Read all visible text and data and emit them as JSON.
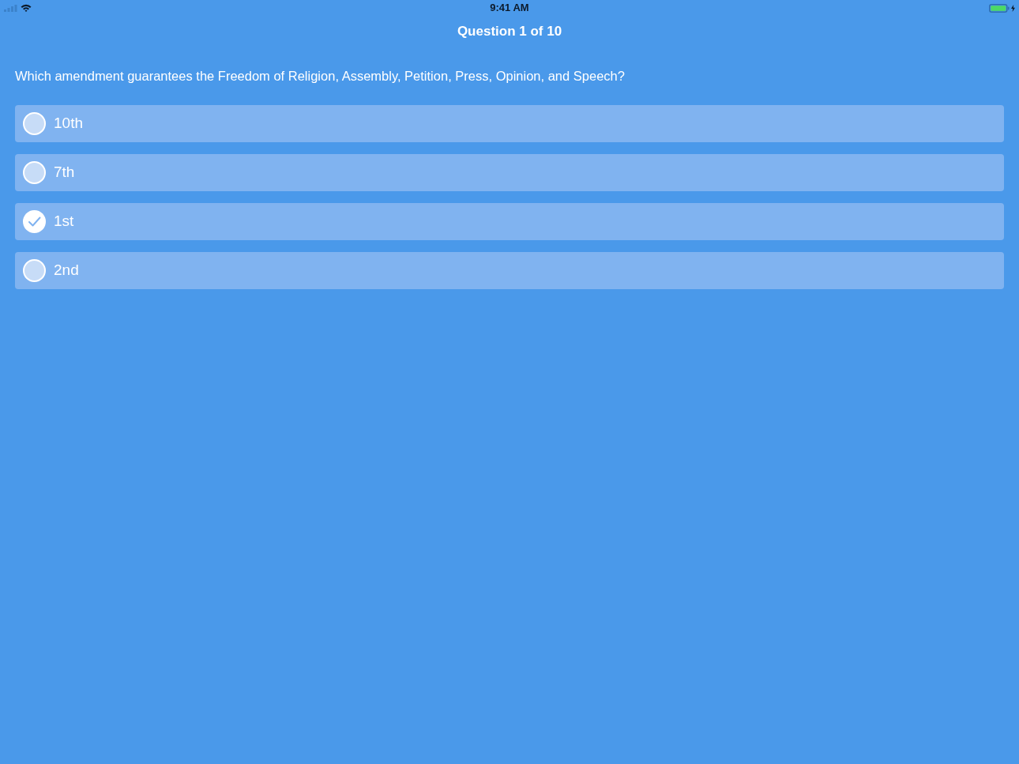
{
  "status_bar": {
    "time": "9:41 AM"
  },
  "title": "Question 1 of 10",
  "question": "Which amendment guarantees the Freedom of Religion, Assembly, Petition, Press, Opinion, and Speech?",
  "options": [
    {
      "label": "10th",
      "selected": false
    },
    {
      "label": "7th",
      "selected": false
    },
    {
      "label": "1st",
      "selected": true
    },
    {
      "label": "2nd",
      "selected": false
    }
  ]
}
